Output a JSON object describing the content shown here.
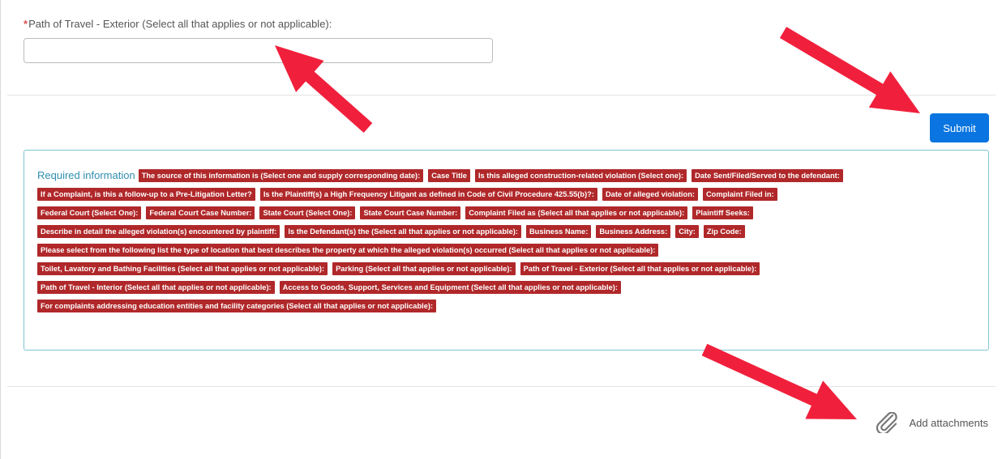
{
  "field": {
    "required_marker": "*",
    "label": "Path of Travel - Exterior (Select all that applies or not applicable):",
    "value": ""
  },
  "submit": {
    "label": "Submit",
    "color": "#0a75e0"
  },
  "required_info": {
    "title": "Required information",
    "tag_color": "#b0282a",
    "rows": [
      [
        "The source of this information is (Select one and supply corresponding date):",
        "Case Title",
        "Is this alleged construction-related violation (Select one):",
        "Date Sent/Filed/Served to the defendant:"
      ],
      [
        "If a Complaint, is this a follow-up to a Pre-Litigation Letter?",
        "Is the Plaintiff(s) a High Frequency Litigant as defined in Code of Civil Procedure 425.55(b)?:",
        "Date of alleged violation:",
        "Complaint Filed in:"
      ],
      [
        "Federal Court (Select One):",
        "Federal Court Case Number:",
        "State Court (Select One):",
        "State Court Case Number:",
        "Complaint Filed as (Select all that applies or not applicable):",
        "Plaintiff Seeks:"
      ],
      [
        "Describe in detail the alleged violation(s) encountered by plaintiff:",
        "Is the Defendant(s) the (Select all that applies or not applicable):",
        "Business Name:",
        "Business Address:",
        "City:",
        "Zip Code:"
      ],
      [
        "Please select from the following list the type of location that best describes the property at which the alleged violation(s) occurred (Select all that applies or not applicable):"
      ],
      [
        "Toilet, Lavatory and Bathing Facilities (Select all that applies or not applicable):",
        "Parking (Select all that applies or not applicable):",
        "Path of Travel - Exterior (Select all that applies or not applicable):"
      ],
      [
        "Path of Travel - Interior (Select all that applies or not applicable):",
        "Access to Goods, Support, Services and Equipment (Select all that applies or not applicable):"
      ],
      [
        "For complaints addressing education entities and facility categories (Select all that applies or not applicable):"
      ]
    ]
  },
  "attachments": {
    "icon": "paperclip-icon",
    "label": "Add attachments"
  },
  "annotation": {
    "arrow_color": "#f0203c",
    "icon": "arrow-icon"
  }
}
